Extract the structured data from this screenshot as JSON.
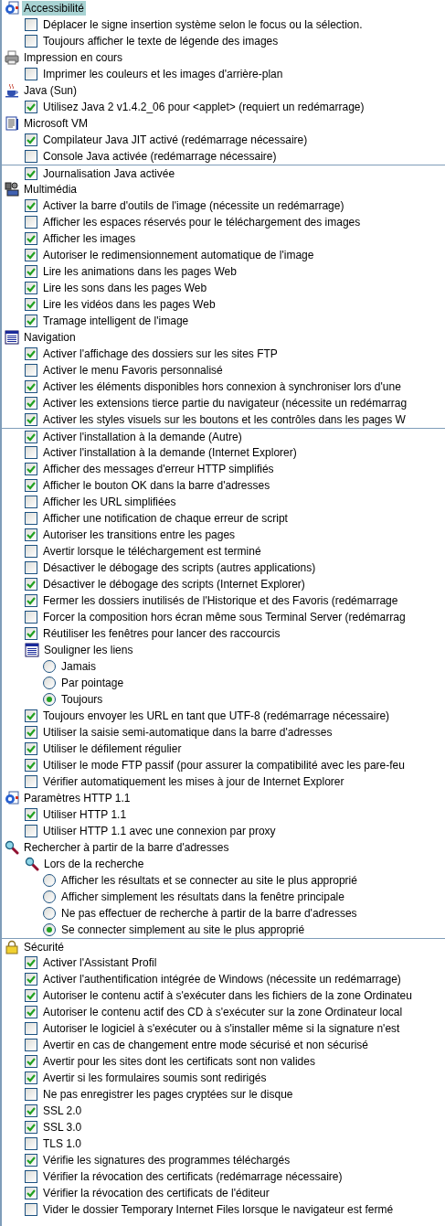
{
  "sections": [
    {
      "title": "Accessibilité",
      "selected": true,
      "items": [
        {
          "kind": "checkbox",
          "label": "Déplacer le signe insertion système selon le focus ou la sélection.",
          "checked": false
        },
        {
          "kind": "checkbox",
          "label": "Toujours afficher le texte de légende des images",
          "checked": false
        }
      ]
    },
    {
      "title": "Impression en cours",
      "selected": false,
      "items": [
        {
          "kind": "checkbox",
          "label": "Imprimer les couleurs et les images d'arrière-plan",
          "checked": false
        }
      ]
    },
    {
      "title": "Java (Sun)",
      "selected": false,
      "items": [
        {
          "kind": "checkbox",
          "label": "Utilisez Java 2 v1.4.2_06 pour <applet> (requiert un redémarrage)",
          "checked": true
        }
      ]
    },
    {
      "title": "Microsoft VM",
      "selected": false,
      "items": [
        {
          "kind": "checkbox",
          "label": "Compilateur Java JIT activé (redémarrage nécessaire)",
          "checked": true
        },
        {
          "kind": "checkbox",
          "label": "Console Java activée (redémarrage nécessaire)",
          "checked": false
        },
        {
          "kind": "checkbox",
          "label": "Journalisation Java activée",
          "checked": true,
          "divider_above": true
        }
      ]
    },
    {
      "title": "Multimédia",
      "selected": false,
      "items": [
        {
          "kind": "checkbox",
          "label": "Activer la barre d'outils de l'image (nécessite un redémarrage)",
          "checked": true
        },
        {
          "kind": "checkbox",
          "label": "Afficher les espaces réservés pour le téléchargement des images",
          "checked": false
        },
        {
          "kind": "checkbox",
          "label": "Afficher les images",
          "checked": true
        },
        {
          "kind": "checkbox",
          "label": "Autoriser le redimensionnement automatique de l'image",
          "checked": true
        },
        {
          "kind": "checkbox",
          "label": "Lire les animations dans les pages Web",
          "checked": true
        },
        {
          "kind": "checkbox",
          "label": "Lire les sons dans les pages Web",
          "checked": true
        },
        {
          "kind": "checkbox",
          "label": "Lire les vidéos dans les pages Web",
          "checked": true
        },
        {
          "kind": "checkbox",
          "label": "Tramage intelligent de l'image",
          "checked": true
        }
      ]
    },
    {
      "title": "Navigation",
      "selected": false,
      "items": [
        {
          "kind": "checkbox",
          "label": "Activer l'affichage des dossiers sur les sites FTP",
          "checked": true
        },
        {
          "kind": "checkbox",
          "label": "Activer le menu Favoris personnalisé",
          "checked": false
        },
        {
          "kind": "checkbox",
          "label": "Activer les éléments disponibles hors connexion à synchroniser lors d'une",
          "checked": true
        },
        {
          "kind": "checkbox",
          "label": "Activer les extensions tierce partie du navigateur (nécessite un redémarrag",
          "checked": true
        },
        {
          "kind": "checkbox",
          "label": "Activer les styles visuels sur les boutons et les contrôles dans les pages W",
          "checked": true
        },
        {
          "kind": "checkbox",
          "label": "Activer l'installation à la demande (Autre)",
          "checked": true,
          "divider_above": true
        },
        {
          "kind": "checkbox",
          "label": "Activer l'installation à la demande (Internet Explorer)",
          "checked": false
        },
        {
          "kind": "checkbox",
          "label": "Afficher des messages d'erreur HTTP simplifiés",
          "checked": true
        },
        {
          "kind": "checkbox",
          "label": "Afficher le bouton OK dans la barre d'adresses",
          "checked": true
        },
        {
          "kind": "checkbox",
          "label": "Afficher les URL simplifiées",
          "checked": false
        },
        {
          "kind": "checkbox",
          "label": "Afficher une notification de chaque erreur de script",
          "checked": false
        },
        {
          "kind": "checkbox",
          "label": "Autoriser les transitions entre les pages",
          "checked": true
        },
        {
          "kind": "checkbox",
          "label": "Avertir lorsque le téléchargement est terminé",
          "checked": false
        },
        {
          "kind": "checkbox",
          "label": "Désactiver le débogage des scripts (autres applications)",
          "checked": false
        },
        {
          "kind": "checkbox",
          "label": "Désactiver le débogage des scripts (Internet Explorer)",
          "checked": true
        },
        {
          "kind": "checkbox",
          "label": "Fermer les dossiers inutilisés de l'Historique et des Favoris (redémarrage",
          "checked": true
        },
        {
          "kind": "checkbox",
          "label": "Forcer la composition hors écran même sous Terminal Server (redémarrag",
          "checked": false
        },
        {
          "kind": "checkbox",
          "label": "Réutiliser les fenêtres pour lancer des raccourcis",
          "checked": true
        },
        {
          "kind": "group",
          "label": "Souligner les liens",
          "children": [
            {
              "kind": "radio",
              "label": "Jamais",
              "selected": false
            },
            {
              "kind": "radio",
              "label": "Par pointage",
              "selected": false
            },
            {
              "kind": "radio",
              "label": "Toujours",
              "selected": true
            }
          ]
        },
        {
          "kind": "checkbox",
          "label": "Toujours envoyer les URL en tant que UTF-8 (redémarrage nécessaire)",
          "checked": true
        },
        {
          "kind": "checkbox",
          "label": "Utiliser la saisie semi-automatique dans la barre d'adresses",
          "checked": true
        },
        {
          "kind": "checkbox",
          "label": "Utiliser le défilement régulier",
          "checked": true
        },
        {
          "kind": "checkbox",
          "label": "Utiliser le mode FTP passif (pour assurer la compatibilité avec les pare-feu",
          "checked": true
        },
        {
          "kind": "checkbox",
          "label": "Vérifier automatiquement les mises à jour de Internet Explorer",
          "checked": false
        }
      ]
    },
    {
      "title": "Paramètres HTTP 1.1",
      "selected": false,
      "items": [
        {
          "kind": "checkbox",
          "label": "Utiliser HTTP 1.1",
          "checked": true
        },
        {
          "kind": "checkbox",
          "label": "Utiliser HTTP 1.1 avec une connexion par proxy",
          "checked": false
        }
      ]
    },
    {
      "title": "Rechercher à partir de la barre d'adresses",
      "selected": false,
      "items": [
        {
          "kind": "group",
          "label": "Lors de la recherche",
          "children": [
            {
              "kind": "radio",
              "label": "Afficher les résultats et se connecter au site le plus approprié",
              "selected": false
            },
            {
              "kind": "radio",
              "label": "Afficher simplement les résultats dans la fenêtre principale",
              "selected": false
            },
            {
              "kind": "radio",
              "label": "Ne pas effectuer de recherche à partir de la barre d'adresses",
              "selected": false
            },
            {
              "kind": "radio",
              "label": "Se connecter simplement au site le plus approprié",
              "selected": true
            }
          ]
        }
      ]
    },
    {
      "title": "Sécurité",
      "selected": false,
      "divider_above": true,
      "items": [
        {
          "kind": "checkbox",
          "label": "Activer l'Assistant Profil",
          "checked": true
        },
        {
          "kind": "checkbox",
          "label": "Activer l'authentification intégrée de Windows (nécessite un redémarrage)",
          "checked": true
        },
        {
          "kind": "checkbox",
          "label": "Autoriser le contenu actif à s'exécuter dans les fichiers de la zone Ordinateu",
          "checked": true
        },
        {
          "kind": "checkbox",
          "label": "Autoriser le contenu actif des CD à s'exécuter sur la zone Ordinateur local",
          "checked": true
        },
        {
          "kind": "checkbox",
          "label": "Autoriser le logiciel à s'exécuter ou à s'installer même si la signature n'est",
          "checked": false
        },
        {
          "kind": "checkbox",
          "label": "Avertir en cas de changement entre mode sécurisé et non sécurisé",
          "checked": false
        },
        {
          "kind": "checkbox",
          "label": "Avertir pour les sites dont les certificats sont non valides",
          "checked": true
        },
        {
          "kind": "checkbox",
          "label": "Avertir si les formulaires soumis sont redirigés",
          "checked": true
        },
        {
          "kind": "checkbox",
          "label": "Ne pas enregistrer les pages cryptées sur le disque",
          "checked": false
        },
        {
          "kind": "checkbox",
          "label": "SSL 2.0",
          "checked": true
        },
        {
          "kind": "checkbox",
          "label": "SSL 3.0",
          "checked": true
        },
        {
          "kind": "checkbox",
          "label": "TLS 1.0",
          "checked": false
        },
        {
          "kind": "checkbox",
          "label": "Vérifie les signatures des programmes téléchargés",
          "checked": true
        },
        {
          "kind": "checkbox",
          "label": "Vérifier la révocation des certificats (redémarrage nécessaire)",
          "checked": false
        },
        {
          "kind": "checkbox",
          "label": "Vérifier la révocation des certificats de l'éditeur",
          "checked": true
        },
        {
          "kind": "checkbox",
          "label": "Vider le dossier Temporary Internet Files lorsque le navigateur est fermé",
          "checked": false
        }
      ]
    }
  ]
}
